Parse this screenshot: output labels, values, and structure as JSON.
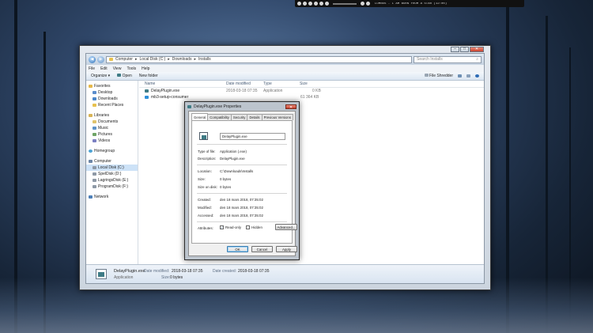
{
  "media_bar": {
    "title": "LUMNOS - I AM BORN FROM A STAR (12:00)"
  },
  "explorer": {
    "breadcrumb": [
      "Computer",
      "Local Disk (C:)",
      "Downloads",
      "Installs"
    ],
    "search_placeholder": "Search Installs",
    "menu": [
      "File",
      "Edit",
      "View",
      "Tools",
      "Help"
    ],
    "toolbar": {
      "organize": "Organize",
      "open": "Open",
      "new_folder": "New folder",
      "file_shredder": "File Shredder"
    },
    "nav": {
      "favorites": {
        "label": "Favorites",
        "items": [
          "Desktop",
          "Downloads",
          "Recent Places"
        ]
      },
      "libraries": {
        "label": "Libraries",
        "items": [
          "Documents",
          "Music",
          "Pictures",
          "Videos"
        ]
      },
      "homegroup": "Homegroup",
      "computer": {
        "label": "Computer",
        "items": [
          "Local Disk (C:)",
          "SpelDisk (D:)",
          "LagringsDisk (E:)",
          "ProgramDisk (F:)"
        ]
      },
      "network": "Network"
    },
    "columns": [
      "Name",
      "Date modified",
      "Type",
      "Size"
    ],
    "files": [
      {
        "name": "DelayPlugin.exe",
        "date": "2018-03-18 07:35",
        "type": "Application",
        "size": "0 KB"
      },
      {
        "name": "mb3-setup-consumer",
        "date": "",
        "type": "",
        "size": "61 364 KB"
      }
    ],
    "details": {
      "name": "DelayPlugin.exe",
      "type": "Application",
      "modified_label": "Date modified:",
      "modified": "2018-03-18 07:35",
      "created_label": "Date created:",
      "created": "2018-03-18 07:35",
      "size_label": "Size:",
      "size": "0 bytes"
    }
  },
  "dialog": {
    "title": "DelayPlugin.exe Properties",
    "tabs": [
      "General",
      "Compatibility",
      "Security",
      "Details",
      "Previous Versions"
    ],
    "filename": "DelayPlugin.exe",
    "fields": {
      "type_label": "Type of file:",
      "type": "Application (.exe)",
      "desc_label": "Description:",
      "desc": "DelayPlugin.exe",
      "location_label": "Location:",
      "location": "C:\\Downloads\\Installs",
      "size_label": "Size:",
      "size": "0 bytes",
      "size_disk_label": "Size on disk:",
      "size_disk": "0 bytes",
      "created_label": "Created:",
      "created": "den 18 mars 2018, 07:35:02",
      "modified_label": "Modified:",
      "modified": "den 18 mars 2018, 07:35:02",
      "accessed_label": "Accessed:",
      "accessed": "den 18 mars 2018, 07:35:02",
      "attributes_label": "Attributes:",
      "readonly": "Read-only",
      "hidden": "Hidden",
      "advanced": "Advanced..."
    },
    "buttons": {
      "ok": "OK",
      "cancel": "Cancel",
      "apply": "Apply"
    },
    "readonly_checked": true,
    "hidden_checked": false
  }
}
